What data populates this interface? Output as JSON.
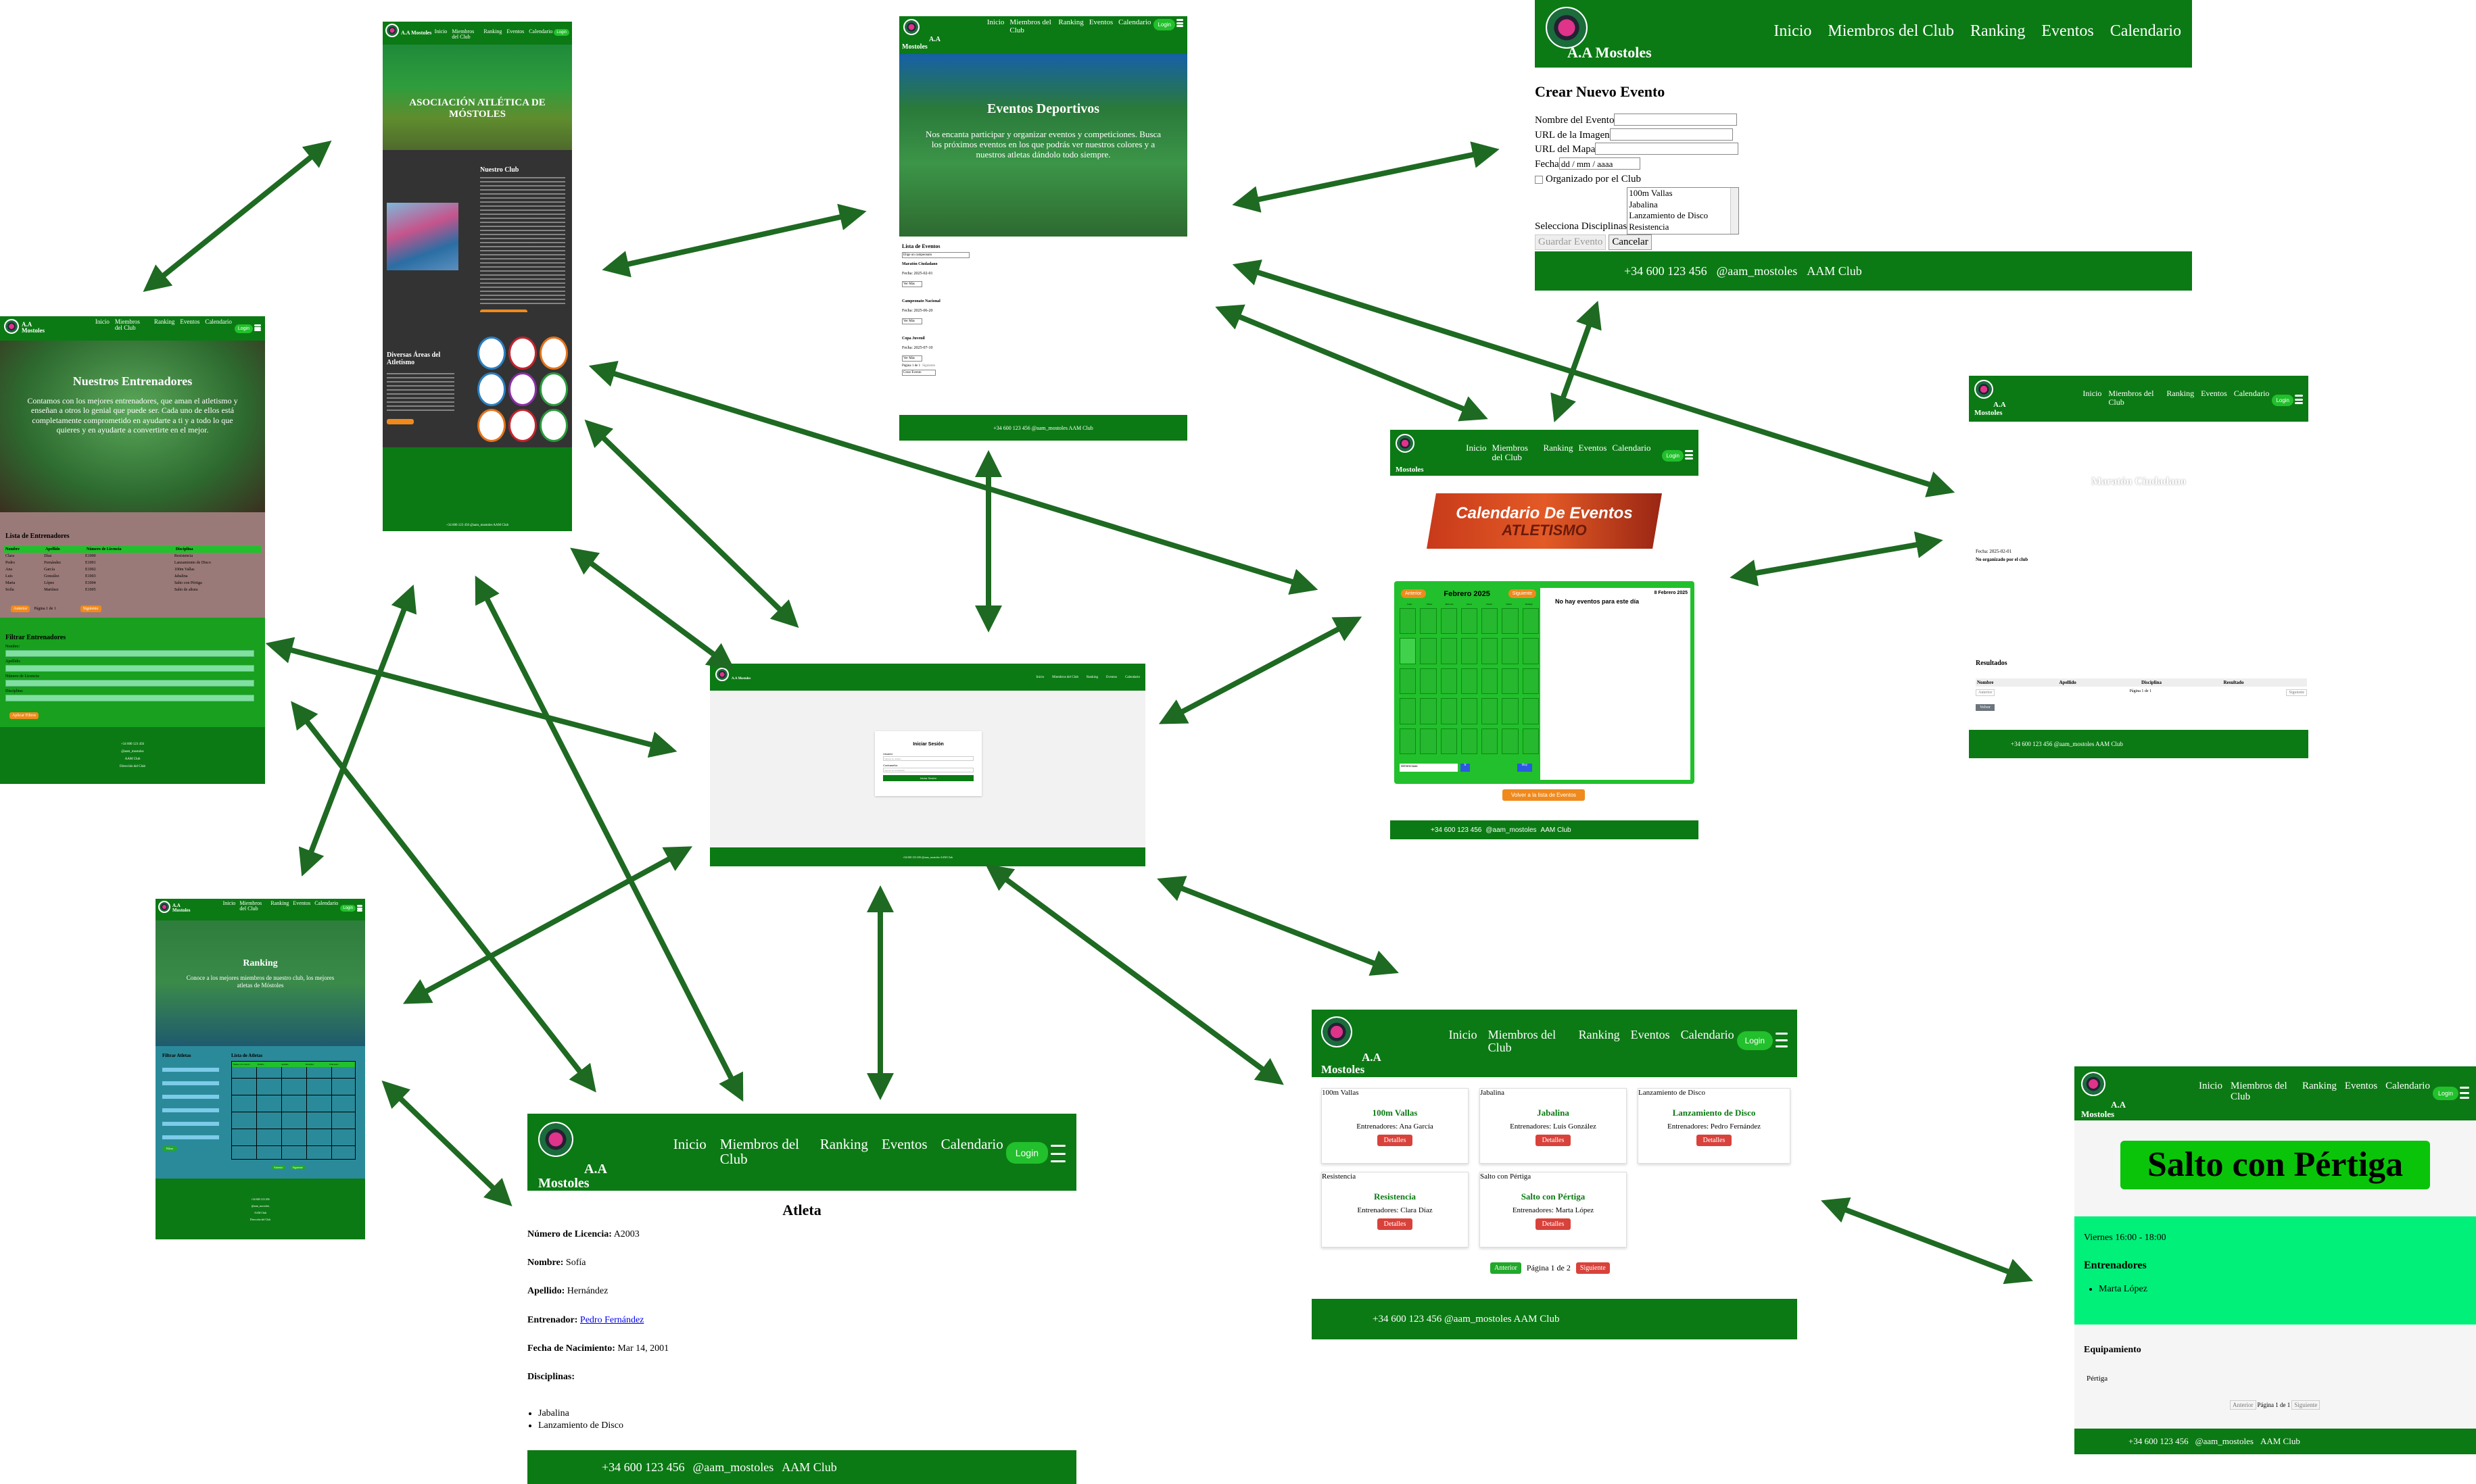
{
  "nav": {
    "brand_line1": "A.A",
    "brand_line2": "Mostoles",
    "brand_full": "A.A Mostoles",
    "links": [
      "Inicio",
      "Miembros del Club",
      "Ranking",
      "Eventos",
      "Calendario"
    ],
    "login": "Login"
  },
  "footer": {
    "phone": "+34 600 123 456",
    "handle": "@aam_mostoles",
    "club": "AAM Club",
    "full": "+34 600 123 456 @aam_mostoles AAM Club",
    "address": "Dirección del Club"
  },
  "home": {
    "hero_title": "ASOCIACIÓN ATLÉTICA DE MÓSTOLES",
    "club_heading": "Nuestro Club",
    "areas_heading": "Diversas Áreas del Atletismo"
  },
  "entrenadores": {
    "hero_title": "Nuestros Entrenadores",
    "hero_text": "Contamos con los mejores entrenadores, que aman el atletismo y enseñan a otros lo genial que puede ser. Cada uno de ellos está completamente comprometido en ayudarte a ti y a todo lo que quieres y en ayudarte a convertirte en el mejor.",
    "list_heading": "Lista de Entrenadores",
    "columns": [
      "Nombre",
      "Apellido",
      "Número de Licencia",
      "Disciplina"
    ],
    "rows": [
      [
        "Clara",
        "Díaz",
        "E1000",
        "Resistencia"
      ],
      [
        "Pedro",
        "Fernández",
        "E1001",
        "Lanzamiento de Disco"
      ],
      [
        "Ana",
        "García",
        "E1002",
        "100m Vallas"
      ],
      [
        "Luis",
        "González",
        "E1003",
        "Jabalina"
      ],
      [
        "Marta",
        "López",
        "E1004",
        "Salto con Pértiga"
      ],
      [
        "Sofía",
        "Martínez",
        "E1005",
        "Salto de altura"
      ]
    ],
    "prev": "Anterior",
    "page": "Página 1 de 1",
    "next": "Siguiente",
    "filters_heading": "Filtrar Entrenadores",
    "filter_labels": [
      "Nombre:",
      "Apellido:",
      "Número de Licencia:",
      "Disciplina:"
    ],
    "apply": "Aplicar Filtros"
  },
  "eventos": {
    "hero_title": "Eventos Deportivos",
    "hero_text": "Nos encanta participar y organizar eventos y competiciones. Busca los próximos eventos en los que podrás ver nuestros colores y a nuestros atletas dándolo todo siempre.",
    "list_heading": "Lista de Eventos",
    "select": "Elige un campeonato",
    "items": [
      {
        "name": "Maratón Ciudadano",
        "date": "Fecha: 2025-02-01"
      },
      {
        "name": "Campeonato Nacional",
        "date": "Fecha: 2025-06-20"
      },
      {
        "name": "Copa Juvenil",
        "date": "Fecha: 2025-07-10"
      }
    ],
    "see_more": "Ver Más",
    "page": "Página 1 de 1",
    "next": "Siguiente",
    "create": "Crear Evento"
  },
  "crear": {
    "title": "Crear Nuevo Evento",
    "fields": [
      "Nombre del Evento",
      "URL de la Imagen",
      "URL del Mapa",
      "Fecha"
    ],
    "date_placeholder": "dd / mm / aaaa",
    "checkbox": "Organizado por el Club",
    "options": [
      "100m Vallas",
      "Jabalina",
      "Lanzamiento de Disco",
      "Resistencia"
    ],
    "select_label": "Selecciona Disciplinas",
    "save": "Guardar Evento",
    "cancel": "Cancelar"
  },
  "maraton": {
    "title": "Maratón Ciudadano",
    "date": "Fecha: 2025-02-01",
    "org": "No organizado por el club",
    "results_heading": "Resultados",
    "columns": [
      "Nombre",
      "Apellido",
      "Disciplina",
      "Resultado"
    ],
    "prev": "Anterior",
    "page": "Página 1 de 1",
    "next": "Siguiente",
    "back": "Volver"
  },
  "calendario": {
    "banner": "Calendario De Eventos",
    "banner_sub": "ATLETISMO",
    "prev": "Anterior",
    "month": "Febrero 2025",
    "next": "Siguiente",
    "days": [
      "Lunes",
      "Martes",
      "Miércoles",
      "Jueves",
      "Viernes",
      "Sábado",
      "Domingo"
    ],
    "date_title": "8 Febrero 2025",
    "no_events": "No hay eventos para este día",
    "return": "Volver a la lista de Eventos",
    "date_input": "dd/mm/aaaa",
    "go": "Ir",
    "today": "Hoy"
  },
  "login": {
    "title": "Iniciar Sesión",
    "user_label": "Usuario:",
    "user_placeholder": "Ingrese su usuario",
    "pass_label": "Contraseña:",
    "pass_placeholder": "Ingrese su contraseña",
    "submit": "Iniciar Sesión"
  },
  "ranking": {
    "hero_title": "Ranking",
    "hero_text": "Conoce a los mejores miembros de nuestro club, los mejores atletas de Móstoles",
    "filters_heading": "Filtrar Atletas",
    "list_heading": "Lista de Atletas",
    "columns": [
      "Número de Licencia",
      "Nombre",
      "Apellido",
      "Disciplina",
      "Entrenador"
    ],
    "apply": "Filtrar",
    "prev": "Anterior",
    "next": "Siguiente"
  },
  "atleta": {
    "title": "Atleta",
    "license_label": "Número de Licencia:",
    "license": "A2003",
    "name_label": "Nombre:",
    "name": "Sofía",
    "surname_label": "Apellido:",
    "surname": "Hernández",
    "coach_label": "Entrenador:",
    "coach": "Pedro Fernández",
    "birth_label": "Fecha de Nacimiento:",
    "birth": "Mar 14, 2001",
    "disc_label": "Disciplinas:",
    "disciplines": [
      "Jabalina",
      "Lanzamiento de Disco"
    ]
  },
  "disciplinas": {
    "cards": [
      {
        "alt": "100m Vallas",
        "name": "100m Vallas",
        "coach": "Entrenadores: Ana García"
      },
      {
        "alt": "Jabalina",
        "name": "Jabalina",
        "coach": "Entrenadores: Luis González"
      },
      {
        "alt": "Lanzamiento de Disco",
        "name": "Lanzamiento de Disco",
        "coach": "Entrenadores: Pedro Fernández"
      },
      {
        "alt": "Resistencia",
        "name": "Resistencia",
        "coach": "Entrenadores: Clara Díaz"
      },
      {
        "alt": "Salto con Pértiga",
        "name": "Salto con Pértiga",
        "coach": "Entrenadores: Marta López"
      }
    ],
    "details": "Detalles",
    "prev": "Anterior",
    "page": "Página 1 de 2",
    "next": "Siguiente"
  },
  "pertiga": {
    "title": "Salto con Pértiga",
    "schedule": "Viernes 16:00 - 18:00",
    "coaches_heading": "Entrenadores",
    "coach": "Marta López",
    "equip_heading": "Equipamiento",
    "equip": "Pértiga",
    "prev": "Anterior",
    "page": "Página 1 de 1",
    "next": "Siguiente"
  },
  "colors": {
    "nav": "#0b7a14",
    "arrow": "#1e6a22",
    "accent": "#22c02c",
    "orange": "#f08a1c"
  }
}
